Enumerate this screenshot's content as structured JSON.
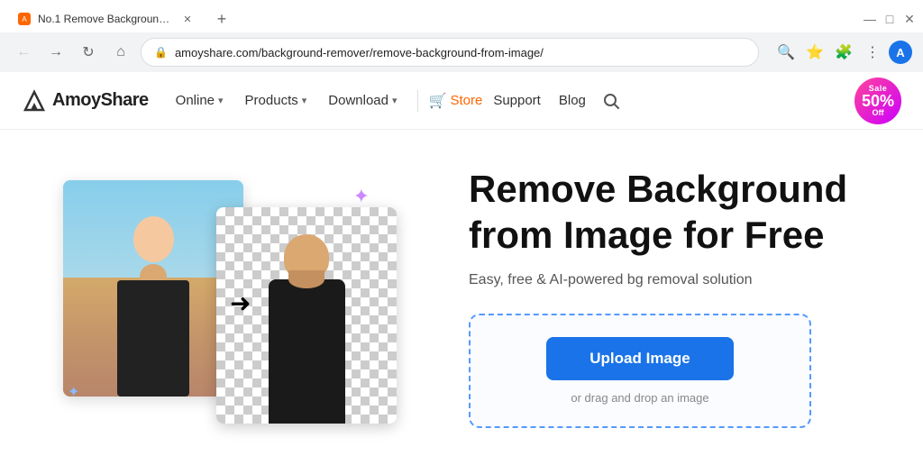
{
  "browser": {
    "tab": {
      "title": "No.1 Remove Background from ...",
      "favicon": "A"
    },
    "url": "amoyshare.com/background-remover/remove-background-from-image/",
    "profile_initial": "A"
  },
  "nav": {
    "logo_text": "AmoyShare",
    "items": [
      {
        "label": "Online",
        "has_chevron": true
      },
      {
        "label": "Products",
        "has_chevron": true
      },
      {
        "label": "Download",
        "has_chevron": true
      }
    ],
    "store_label": "Store",
    "support_label": "Support",
    "blog_label": "Blog",
    "sale": {
      "top": "Sale",
      "percent": "50%",
      "bottom": "Off"
    }
  },
  "hero": {
    "headline_line1": "Remove Background",
    "headline_line2": "from Image for Free",
    "subtext": "Easy, free & AI-powered bg removal solution",
    "upload_button": "Upload Image",
    "drag_text": "or drag and drop an image"
  },
  "colors": {
    "accent_blue": "#1a73e8",
    "store_orange": "#ff6600",
    "sale_pink": "#ff4499",
    "upload_border": "#5599ff"
  }
}
